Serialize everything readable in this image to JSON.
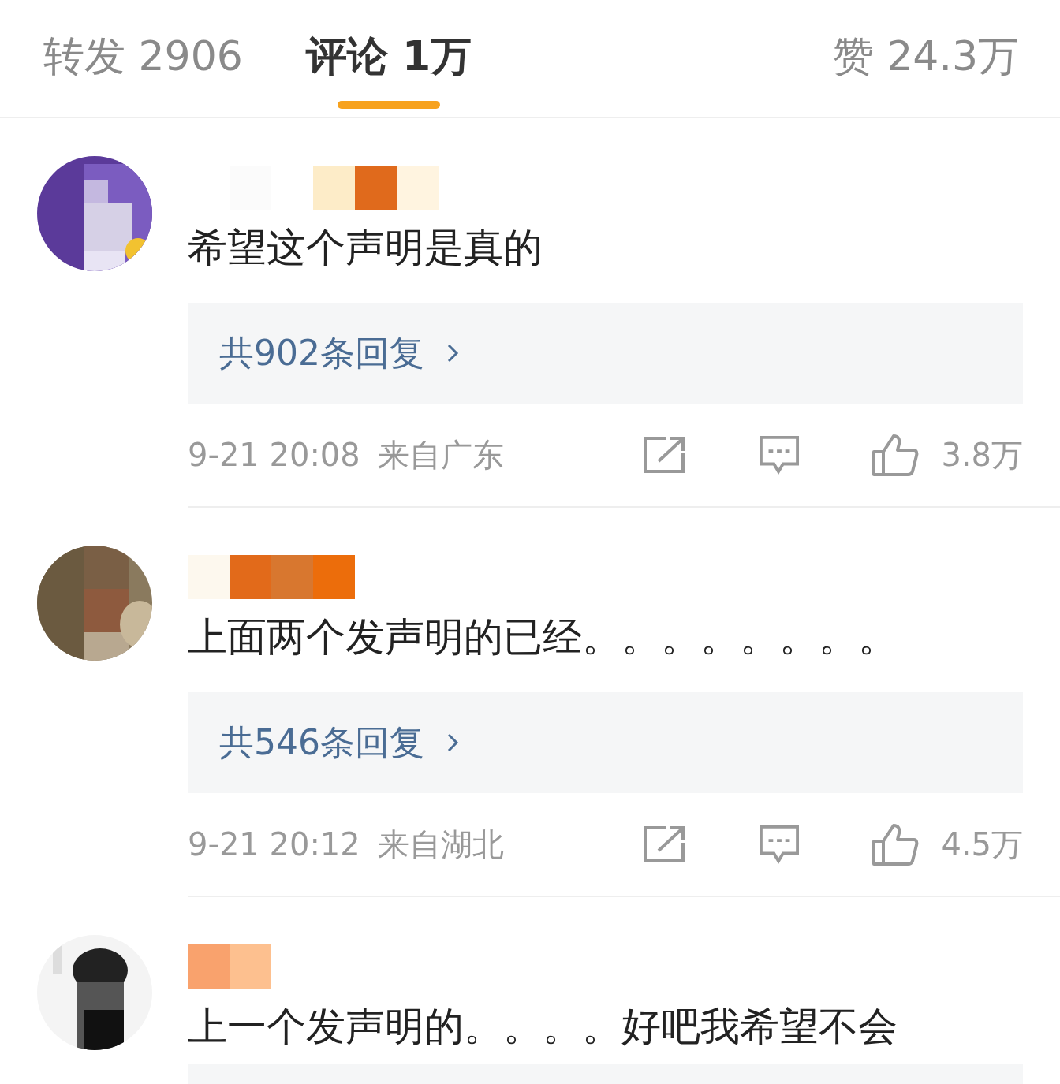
{
  "tabs": [
    {
      "label": "转发 2906",
      "selected": false
    },
    {
      "label": "评论 1万",
      "selected": true
    },
    {
      "label": "赞 24.3万",
      "selected": false
    }
  ],
  "comments": [
    {
      "kind": "full",
      "text": "希望这个声明是真的",
      "replies": "共902条回复",
      "time": "9-21 20:08",
      "location": "来自广东",
      "likes": "3.8万"
    },
    {
      "kind": "full",
      "text": "上面两个发声明的已经。。。。。。。。",
      "replies": "共546条回复",
      "time": "9-21 20:12",
      "location": "来自湖北",
      "likes": "4.5万"
    },
    {
      "kind": "cut",
      "text": "上一个发声明的。。。。好吧我希望不会"
    }
  ]
}
